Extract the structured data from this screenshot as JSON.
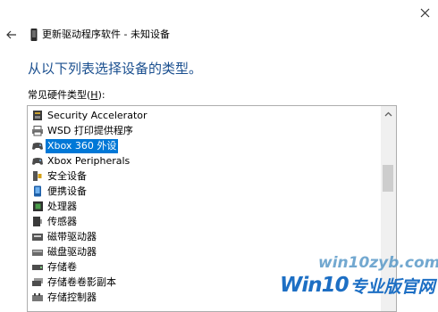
{
  "window": {
    "title": "更新驱动程序软件 - 未知设备"
  },
  "main": {
    "heading": "从以下列表选择设备的类型。",
    "list_label_prefix": "常见硬件类型(",
    "list_label_accel": "H",
    "list_label_suffix": "):",
    "items": [
      {
        "label": "Security Accelerator",
        "icon": "security-accelerator-icon"
      },
      {
        "label": "WSD 打印提供程序",
        "icon": "printer-icon"
      },
      {
        "label": "Xbox 360 外设",
        "icon": "gamepad-icon",
        "selected": true
      },
      {
        "label": "Xbox Peripherals",
        "icon": "gamepad-icon"
      },
      {
        "label": "安全设备",
        "icon": "security-device-icon"
      },
      {
        "label": "便携设备",
        "icon": "portable-device-icon"
      },
      {
        "label": "处理器",
        "icon": "processor-icon"
      },
      {
        "label": "传感器",
        "icon": "sensor-icon"
      },
      {
        "label": "磁带驱动器",
        "icon": "tape-drive-icon"
      },
      {
        "label": "磁盘驱动器",
        "icon": "disk-drive-icon"
      },
      {
        "label": "存储卷",
        "icon": "storage-volume-icon"
      },
      {
        "label": "存储卷卷影副本",
        "icon": "shadow-copy-icon"
      },
      {
        "label": "存储控制器",
        "icon": "storage-controller-icon"
      }
    ]
  },
  "watermark": {
    "site": "win10zyb.com",
    "logo_win": "Win10",
    "logo_rest": "专业版官网"
  },
  "colors": {
    "heading": "#1a4f8f",
    "selection": "#0078d7",
    "watermark": "#1d6fc4"
  }
}
